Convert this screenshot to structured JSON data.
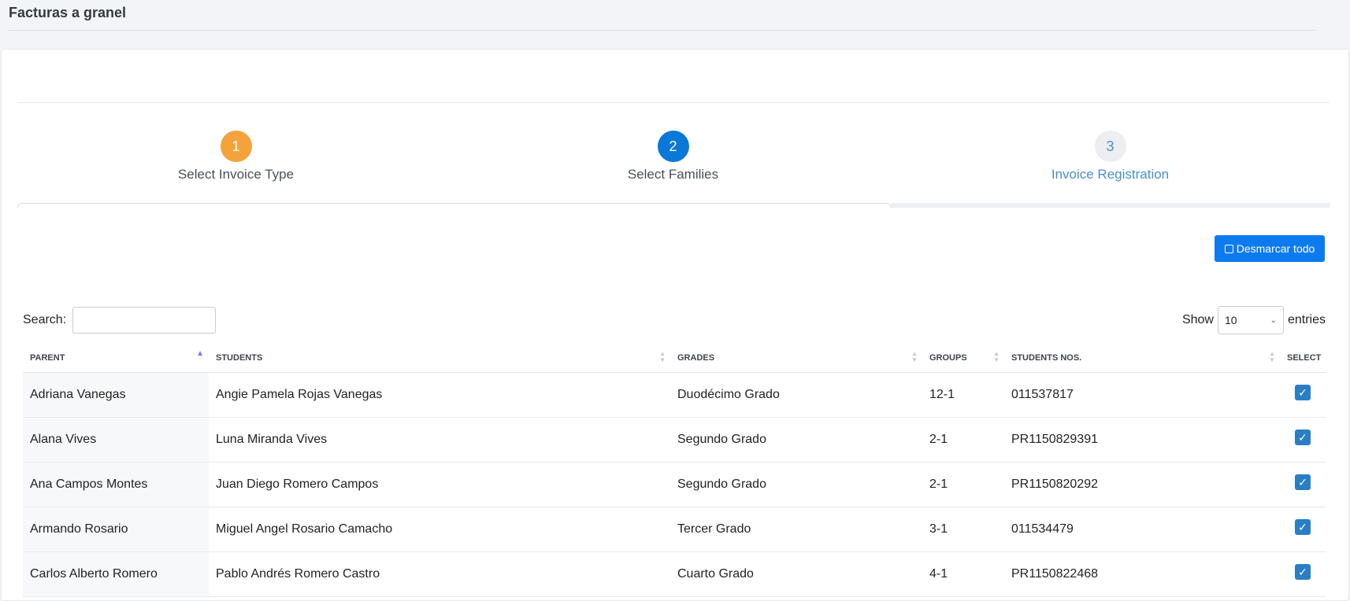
{
  "page": {
    "title": "Facturas a granel"
  },
  "wizard": {
    "steps": [
      {
        "number": "1",
        "label": "Select Invoice Type",
        "state": "done"
      },
      {
        "number": "2",
        "label": "Select Families",
        "state": "active"
      },
      {
        "number": "3",
        "label": "Invoice Registration",
        "state": "pending"
      }
    ]
  },
  "toolbar": {
    "unmark_all_label": "Desmarcar todo"
  },
  "search": {
    "label": "Search:",
    "value": "",
    "placeholder": ""
  },
  "length": {
    "show_label": "Show",
    "selected": "10",
    "entries_label": "entries"
  },
  "table": {
    "columns": [
      "PARENT",
      "STUDENTS",
      "GRADES",
      "GROUPS",
      "STUDENTS NOS.",
      "SELECT"
    ],
    "sort_column": "PARENT",
    "sort_direction": "asc",
    "rows": [
      {
        "parent": "Adriana Vanegas",
        "students": "Angie Pamela Rojas Vanegas",
        "grades": "Duodécimo Grado",
        "groups": "12-1",
        "student_nos": "011537817",
        "selected": true
      },
      {
        "parent": "Alana Vives",
        "students": "Luna Miranda Vives",
        "grades": "Segundo Grado",
        "groups": "2-1",
        "student_nos": "PR1150829391",
        "selected": true
      },
      {
        "parent": "Ana Campos Montes",
        "students": "Juan Diego Romero Campos",
        "grades": "Segundo Grado",
        "groups": "2-1",
        "student_nos": "PR1150820292",
        "selected": true
      },
      {
        "parent": "Armando Rosario",
        "students": "Miguel Angel Rosario Camacho",
        "grades": "Tercer Grado",
        "groups": "3-1",
        "student_nos": "011534479",
        "selected": true
      },
      {
        "parent": "Carlos Alberto Romero",
        "students": "Pablo Andrés Romero Castro",
        "grades": "Cuarto Grado",
        "groups": "4-1",
        "student_nos": "PR1150822468",
        "selected": true
      }
    ]
  },
  "colors": {
    "step_done": "#f4a23a",
    "step_active": "#0a78d8",
    "step_pending_text": "#4a8ecf",
    "primary_button": "#0d7bf0",
    "checkbox": "#2a7ec6"
  }
}
